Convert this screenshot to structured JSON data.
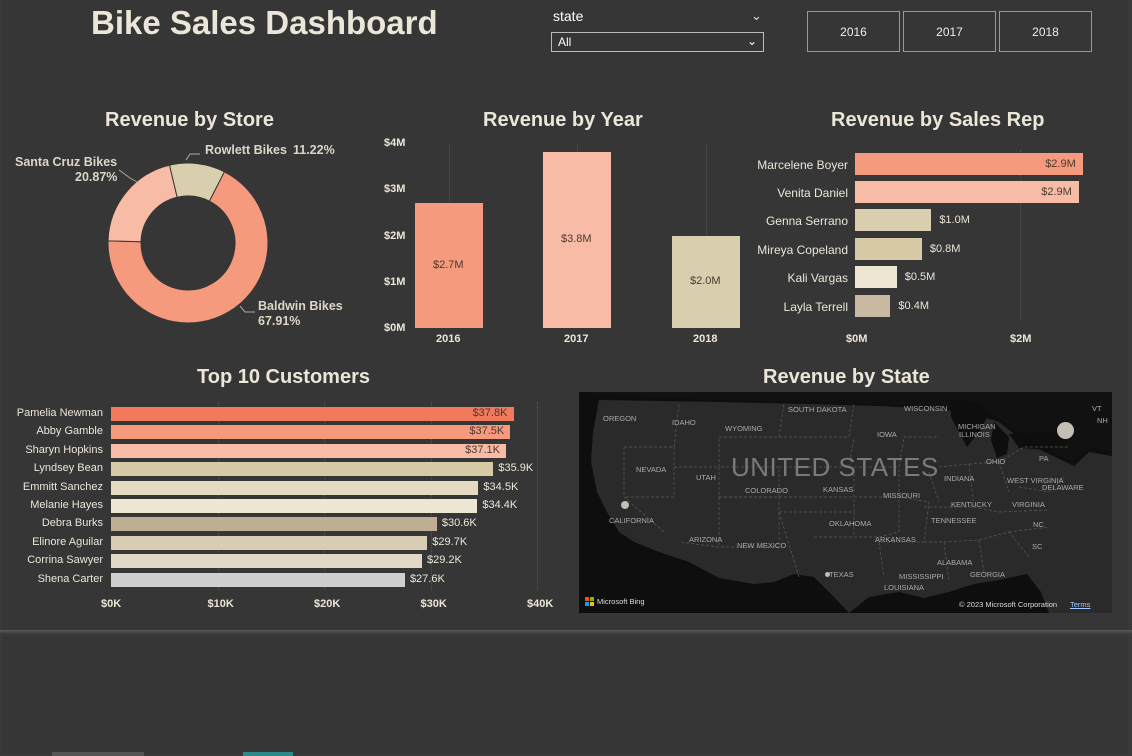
{
  "dashboard": {
    "title": "Bike Sales Dashboard",
    "state_slicer": {
      "label": "state",
      "value": "All"
    },
    "year_buttons": [
      "2016",
      "2017",
      "2018"
    ]
  },
  "colors": {
    "background": "#363636",
    "salmon": "#f59a7d",
    "peach": "#f8bba6",
    "tan": "#d9cfae",
    "sand": "#d6c9a6",
    "cream": "#ece6d2",
    "taupe": "#bfae92",
    "text": "#ece6d8"
  },
  "revenue_by_store": {
    "title": "Revenue by Store",
    "chart_data": {
      "type": "pie",
      "donut": true,
      "title": "Revenue by Store",
      "categories": [
        "Baldwin Bikes",
        "Santa Cruz Bikes",
        "Rowlett Bikes"
      ],
      "values": [
        67.91,
        20.87,
        11.22
      ],
      "unit": "%",
      "labels": [
        {
          "name": "Baldwin Bikes",
          "pct": "67.91%"
        },
        {
          "name": "Santa Cruz Bikes",
          "pct": "20.87%"
        },
        {
          "name": "Rowlett Bikes",
          "pct": "11.22%"
        }
      ],
      "colors": [
        "#f59a7d",
        "#f8bba6",
        "#d9cfae"
      ]
    }
  },
  "revenue_by_year": {
    "title": "Revenue by Year",
    "chart_data": {
      "type": "bar",
      "title": "Revenue by Year",
      "categories": [
        "2016",
        "2017",
        "2018"
      ],
      "values": [
        2.7,
        3.8,
        2.0
      ],
      "value_labels": [
        "$2.7M",
        "$3.8M",
        "$2.0M"
      ],
      "unit": "$M",
      "ylim": [
        0,
        4
      ],
      "yticks": [
        "$0M",
        "$1M",
        "$2M",
        "$3M",
        "$4M"
      ],
      "colors": [
        "#f59a7d",
        "#f8bba6",
        "#d9cfae"
      ]
    }
  },
  "revenue_by_rep": {
    "title": "Revenue by Sales Rep",
    "chart_data": {
      "type": "bar",
      "orientation": "horizontal",
      "title": "Revenue by Sales Rep",
      "categories": [
        "Marcelene Boyer",
        "Venita Daniel",
        "Genna Serrano",
        "Mireya Copeland",
        "Kali Vargas",
        "Layla Terrell"
      ],
      "values": [
        2.9,
        2.85,
        0.97,
        0.85,
        0.53,
        0.45
      ],
      "value_labels": [
        "$2.9M",
        "$2.9M",
        "$1.0M",
        "$0.8M",
        "$0.5M",
        "$0.4M"
      ],
      "unit": "$M",
      "xlim": [
        0,
        3.05
      ],
      "xticks": [
        "$0M",
        "$2M"
      ],
      "colors": [
        "#f59a7d",
        "#f8bba6",
        "#d9cfae",
        "#d6c9a6",
        "#ece6d2",
        "#c9b8a2"
      ]
    }
  },
  "top_customers": {
    "title": "Top 10 Customers",
    "chart_data": {
      "type": "bar",
      "orientation": "horizontal",
      "title": "Top 10 Customers",
      "categories": [
        "Pamelia Newman",
        "Abby Gamble",
        "Sharyn Hopkins",
        "Lyndsey Bean",
        "Emmitt Sanchez",
        "Melanie Hayes",
        "Debra Burks",
        "Elinore Aguilar",
        "Corrina Sawyer",
        "Shena Carter"
      ],
      "values": [
        37.8,
        37.5,
        37.1,
        35.9,
        34.5,
        34.4,
        30.6,
        29.7,
        29.2,
        27.6
      ],
      "value_labels": [
        "$37.8K",
        "$37.5K",
        "$37.1K",
        "$35.9K",
        "$34.5K",
        "$34.4K",
        "$30.6K",
        "$29.7K",
        "$29.2K",
        "$27.6K"
      ],
      "unit": "$K",
      "xlim": [
        0,
        40
      ],
      "xticks": [
        "$0K",
        "$10K",
        "$20K",
        "$30K",
        "$40K"
      ],
      "colors": [
        "#f27a5c",
        "#f59a7d",
        "#f8bba6",
        "#d6c9a6",
        "#e4dbc2",
        "#ece6d2",
        "#bfae92",
        "#d9ccb5",
        "#e2d8c8",
        "#cfcfcf"
      ]
    }
  },
  "revenue_by_state": {
    "title": "Revenue by State",
    "map_labels": {
      "country": "UNITED STATES",
      "states": [
        "OREGON",
        "IDAHO",
        "WYOMING",
        "SOUTH DAKOTA",
        "WISCONSIN",
        "MICHIGAN",
        "IOWA",
        "NEVADA",
        "UTAH",
        "COLORADO",
        "KANSAS",
        "MISSOURI",
        "ILLINOIS",
        "INDIANA",
        "OHIO",
        "PA",
        "WEST VIRGINIA",
        "VIRGINIA",
        "DELAWARE",
        "KENTUCKY",
        "CALIFORNIA",
        "ARIZONA",
        "NEW MEXICO",
        "OKLAHOMA",
        "TENNESSEE",
        "NC",
        "SC",
        "ARKANSAS",
        "ALABAMA",
        "GEORGIA",
        "MISSISSIPPI",
        "LOUISIANA",
        "TEXAS",
        "VT",
        "NH"
      ]
    },
    "bubbles": [
      {
        "state": "New York",
        "size": "large"
      },
      {
        "state": "California",
        "size": "small"
      },
      {
        "state": "Texas",
        "size": "small"
      }
    ],
    "attribution": "Microsoft Bing",
    "copyright": "© 2023 Microsoft Corporation",
    "terms": "Terms"
  }
}
